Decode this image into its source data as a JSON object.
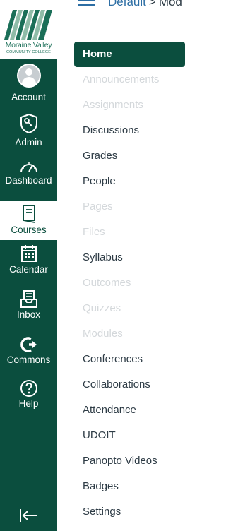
{
  "logo": {
    "line1": "Moraine Valley",
    "line2": "COMMUNITY COLLEGE"
  },
  "global_nav": {
    "account": "Account",
    "admin": "Admin",
    "dashboard": "Dashboard",
    "courses": "Courses",
    "calendar": "Calendar",
    "inbox": "Inbox",
    "commons": "Commons",
    "help": "Help"
  },
  "breadcrumb": {
    "course": "Default",
    "separator": ">",
    "current": "Mod"
  },
  "course_nav": {
    "home": "Home",
    "items": [
      {
        "label": "Announcements",
        "disabled": true
      },
      {
        "label": "Assignments",
        "disabled": true
      },
      {
        "label": "Discussions",
        "disabled": false
      },
      {
        "label": "Grades",
        "disabled": false
      },
      {
        "label": "People",
        "disabled": false
      },
      {
        "label": "Pages",
        "disabled": true
      },
      {
        "label": "Files",
        "disabled": true
      },
      {
        "label": "Syllabus",
        "disabled": false
      },
      {
        "label": "Outcomes",
        "disabled": true
      },
      {
        "label": "Quizzes",
        "disabled": true
      },
      {
        "label": "Modules",
        "disabled": true
      },
      {
        "label": "Conferences",
        "disabled": false
      },
      {
        "label": "Collaborations",
        "disabled": false
      },
      {
        "label": "Attendance",
        "disabled": false
      },
      {
        "label": "UDOIT",
        "disabled": false
      },
      {
        "label": "Panopto Videos",
        "disabled": false
      },
      {
        "label": "Badges",
        "disabled": false
      },
      {
        "label": "Settings",
        "disabled": false
      }
    ]
  },
  "colors": {
    "brand_green": "#0b4e3e",
    "link_blue": "#2d6ea4",
    "text_dark": "#2d3b45",
    "text_disabled": "#d4d8db"
  }
}
